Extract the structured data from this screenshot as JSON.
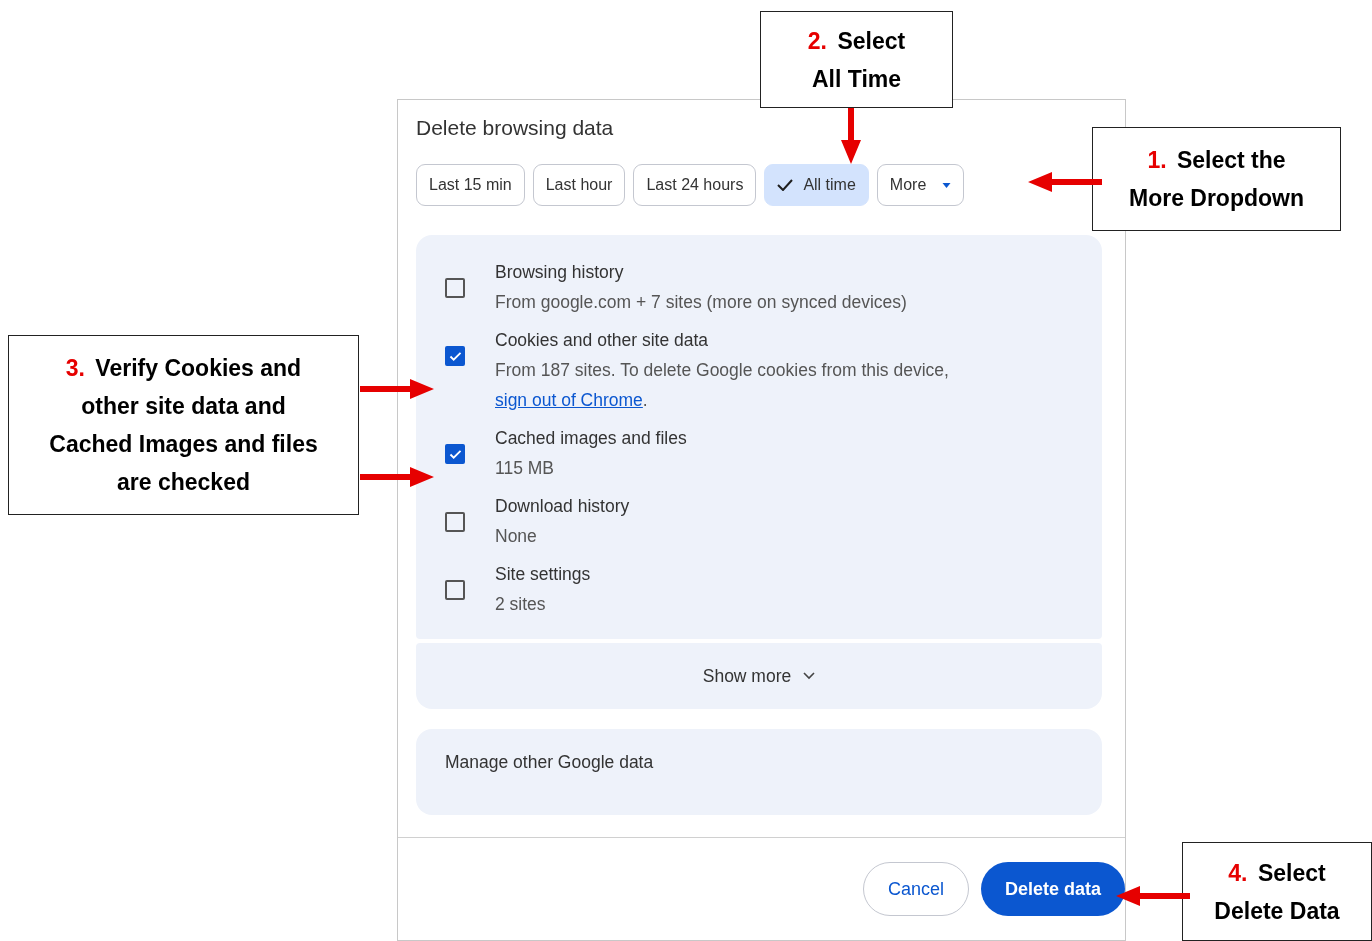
{
  "dialog": {
    "title": "Delete browsing data",
    "time_ranges": [
      {
        "label": "Last 15 min",
        "selected": false
      },
      {
        "label": "Last hour",
        "selected": false
      },
      {
        "label": "Last 24 hours",
        "selected": false
      },
      {
        "label": "All time",
        "selected": true
      }
    ],
    "more_dropdown": {
      "label": "More"
    },
    "items": [
      {
        "label": "Browsing history",
        "description": "From google.com + 7 sites (more on synced devices)",
        "checked": false
      },
      {
        "label": "Cookies and other site data",
        "description": "From 187 sites. To delete Google cookies from this device, ",
        "link": "sign out of Chrome",
        "description_end": ".",
        "checked": true
      },
      {
        "label": "Cached images and files",
        "description": "115 MB",
        "checked": true
      },
      {
        "label": "Download history",
        "description": "None",
        "checked": false
      },
      {
        "label": "Site settings",
        "description": "2 sites",
        "checked": false
      }
    ],
    "show_more": "Show more",
    "manage_other": "Manage other Google data",
    "buttons": {
      "cancel": "Cancel",
      "confirm": "Delete data"
    }
  },
  "callouts": [
    {
      "number": "1.",
      "text": "Select the More Dropdown"
    },
    {
      "number": "2.",
      "text": "Select All Time"
    },
    {
      "number": "3.",
      "text": "Verify Cookies and other site data and Cached Images and files are checked"
    },
    {
      "number": "4.",
      "text": "Select Delete Data"
    }
  ]
}
